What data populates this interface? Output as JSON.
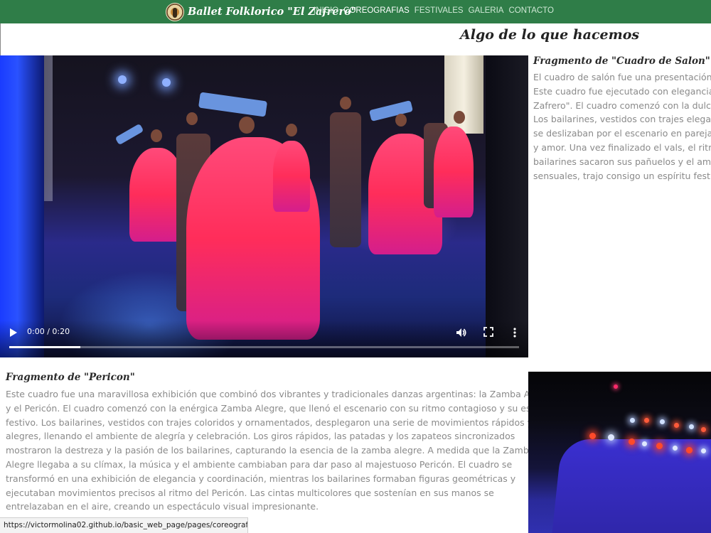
{
  "header": {
    "brand": "Ballet Folklorico \"El Zafrero\"",
    "nav": [
      {
        "label": "INICIO",
        "active": false
      },
      {
        "label": "COREOGRAFIAS",
        "active": true
      },
      {
        "label": "FESTIVALES",
        "active": false
      },
      {
        "label": "GALERIA",
        "active": false
      },
      {
        "label": "CONTACTO",
        "active": false
      }
    ]
  },
  "section_title": "Algo de lo que hacemos",
  "video1": {
    "time": "0:00 / 0:20",
    "progress_fraction": 0.14
  },
  "fragment1": {
    "title": "Fragmento de \"Cuadro de Salon\"",
    "lines": [
      "El cuadro de salón fue una presentación c",
      "Este cuadro fue ejecutado con elegancia y",
      "Zafrero\". El cuadro comenzó con la dulce m",
      "Los bailarines, vestidos con trajes elegante",
      "se deslizaban por el escenario en parejas.",
      "y amor. Una vez finalizado el vals, el ritmo",
      "bailarines sacaron sus pañuelos y el ambie",
      "sensuales, trajo consigo un espíritu festivo"
    ]
  },
  "fragment2": {
    "title": "Fragmento de \"Pericon\"",
    "lines": [
      "Este cuadro fue una maravillosa exhibición que combinó dos vibrantes y tradicionales danzas argentinas: la Zamba Alegre",
      "y el Pericón. El cuadro comenzó con la enérgica Zamba Alegre, que llenó el escenario con su ritmo contagioso y su espíritu",
      "festivo. Los bailarines, vestidos con trajes coloridos y ornamentados, desplegaron una serie de movimientos rápidos y",
      "alegres, llenando el ambiente de alegría y celebración. Los giros rápidos, las patadas y los zapateos sincronizados",
      "mostraron la destreza y la pasión de los bailarines, capturando la esencia de la zamba alegre. A medida que la Zamba",
      "Alegre llegaba a su clímax, la música y el ambiente cambiaban para dar paso al majestuoso Pericón. El cuadro se",
      "transformó en una exhibición de elegancia y coordinación, mientras los bailarines formaban figuras geométricas y",
      "ejecutaban movimientos precisos al ritmo del Pericón. Las cintas multicolores que sostenían en sus manos se",
      "entrelazaban en el aire, creando un espectáculo visual impresionante."
    ]
  },
  "status_url": "https://victormolina02.github.io/basic_web_page/pages/coreografias.html#",
  "icons": {
    "logo": "dancer-logo-icon",
    "play": "play-icon",
    "volume": "volume-icon",
    "fullscreen": "fullscreen-icon",
    "more": "more-vertical-icon"
  },
  "colors": {
    "header_bg": "#2f7d48",
    "text_gray": "#8a8a8a"
  }
}
